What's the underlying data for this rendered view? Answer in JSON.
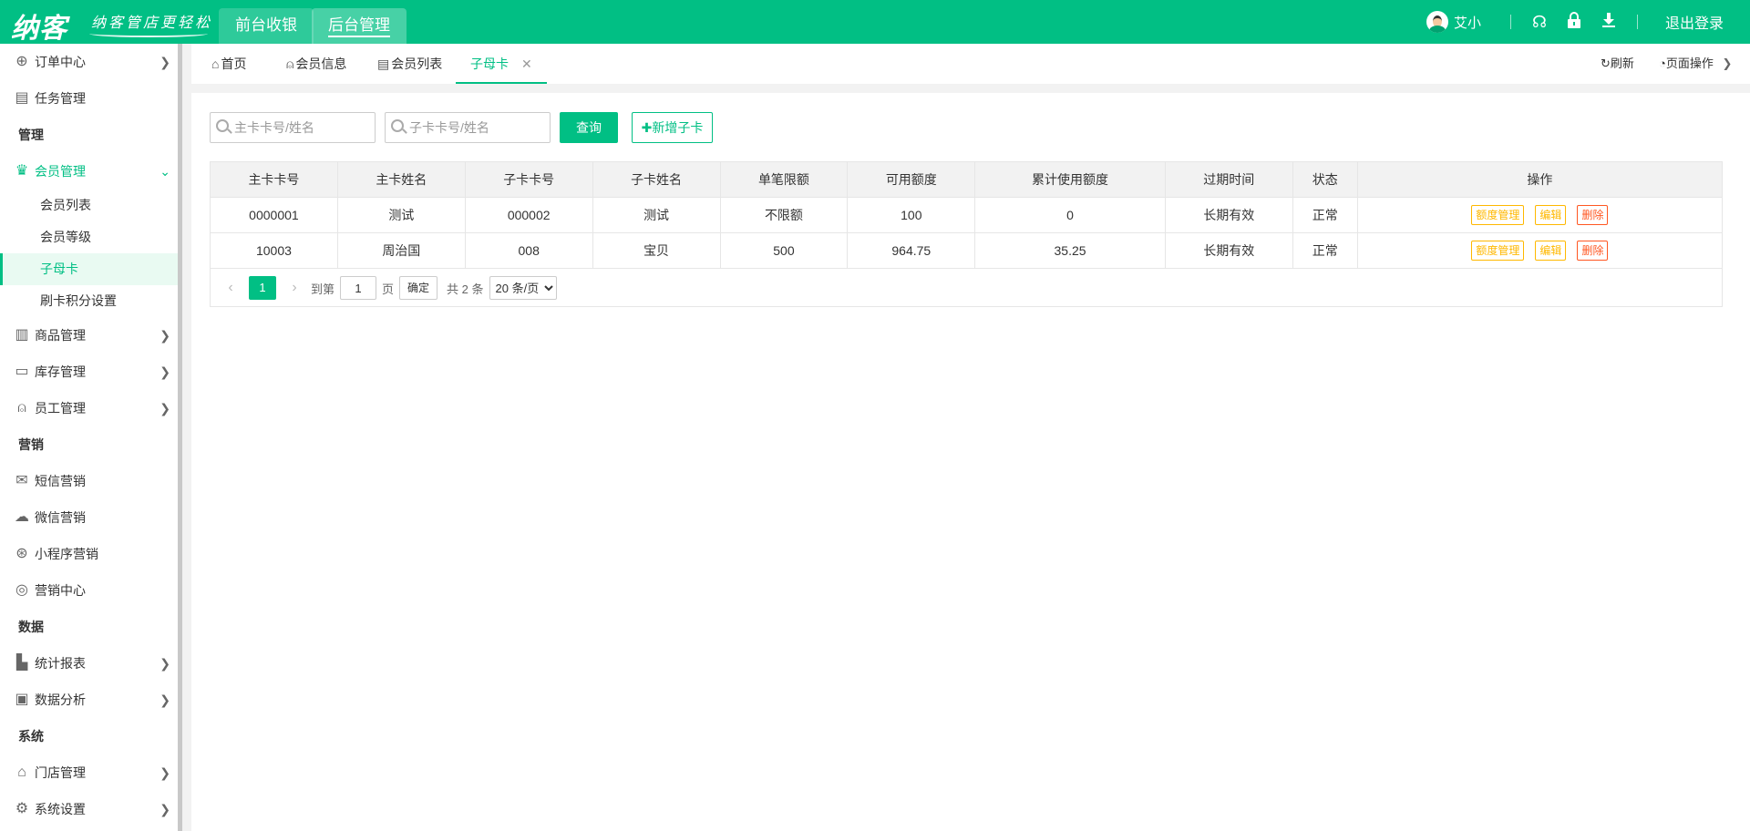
{
  "header": {
    "logo": "纳客",
    "slogan": "纳客管店更轻松",
    "nav_front": "前台收银",
    "nav_back": "后台管理",
    "username": "艾小",
    "logout": "退出登录",
    "brand_color": "#01bf84"
  },
  "sidebar": {
    "order_center": "订单中心",
    "task_mgmt": "任务管理",
    "section_manage": "管理",
    "member_mgmt": "会员管理",
    "member_list": "会员列表",
    "member_level": "会员等级",
    "sub_card": "子母卡",
    "swipe_points": "刷卡积分设置",
    "goods_mgmt": "商品管理",
    "stock_mgmt": "库存管理",
    "staff_mgmt": "员工管理",
    "section_marketing": "营销",
    "sms_marketing": "短信营销",
    "wechat_marketing": "微信营销",
    "miniapp_marketing": "小程序营销",
    "marketing_center": "营销中心",
    "section_data": "数据",
    "stats_report": "统计报表",
    "data_analysis": "数据分析",
    "section_system": "系统",
    "store_mgmt": "门店管理",
    "system_settings": "系统设置"
  },
  "tabs": {
    "home": "首页",
    "member_info": "会员信息",
    "member_list": "会员列表",
    "sub_card": "子母卡",
    "refresh": "刷新",
    "page_ops": "页面操作"
  },
  "search": {
    "main_placeholder": "主卡卡号/姓名",
    "sub_placeholder": "子卡卡号/姓名",
    "query_label": "查询",
    "add_label": "✚新增子卡"
  },
  "table": {
    "headers": [
      "主卡卡号",
      "主卡姓名",
      "子卡卡号",
      "子卡姓名",
      "单笔限额",
      "可用额度",
      "累计使用额度",
      "过期时间",
      "状态",
      "操作"
    ],
    "rows": [
      [
        "0000001",
        "测试",
        "000002",
        "测试",
        "不限额",
        "100",
        "0",
        "长期有效",
        "正常"
      ],
      [
        "10003",
        "周治国",
        "008",
        "宝贝",
        "500",
        "964.75",
        "35.25",
        "长期有效",
        "正常"
      ]
    ],
    "op_quota": "额度管理",
    "op_edit": "编辑",
    "op_delete": "删除"
  },
  "pager": {
    "current_page": "1",
    "goto_label": "到第",
    "goto_value": "1",
    "page_unit": "页",
    "ok_label": "确定",
    "total_label": "共 2 条",
    "page_size": "20 条/页"
  }
}
